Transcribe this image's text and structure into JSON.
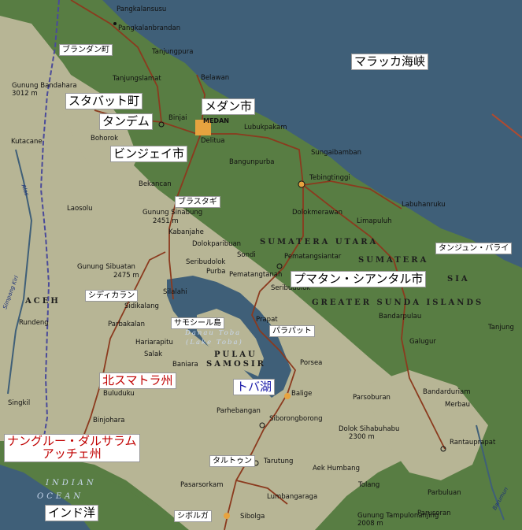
{
  "map": {
    "japanese_labels": {
      "malacca_strait": "マラッカ海峡",
      "medan_city": "メダン市",
      "stabat": "スタバット町",
      "tandem": "タンデム",
      "binjai_city": "ビンジェイ市",
      "brandan": "ブランダン町",
      "berastagi": "ブラスタギ",
      "tanjung_balai": "タンジュン・バライ",
      "pematangsiantar_city": "プマタン・シアンタル市",
      "sidikalang": "シディカラン",
      "samosir_island": "サモシール島",
      "parapat": "パラパット",
      "north_sumatra": "北スマトラ州",
      "lake_toba": "トバ湖",
      "aceh_province_line1": "ナングルー・ダルサラム",
      "aceh_province_line2": "アッチェ州",
      "tarutung": "タルトゥン",
      "indian_ocean": "インド洋",
      "sibolga": "シボルガ"
    },
    "places": {
      "pangkalansusu": "Pangkalansusu",
      "pangkalanbrandan": "Pangkalanbrandan",
      "tanjungpura": "Tanjungpura",
      "tanjungslamat": "Tanjungslamat",
      "belawan": "Belawan",
      "binjai": "Binjai",
      "medan": "MEDAN",
      "delitua": "Delitua",
      "bohorok": "Bohorok",
      "lubukpakam": "Lubukpakam",
      "kutacane": "Kutacane",
      "sungaibamban": "Sungaibamban",
      "bangunpurba": "Bangunpurba",
      "tebingtinggi": "Tebingtinggi",
      "bekancan": "Bekancan",
      "laosolu": "Laosolu",
      "kabanjahe": "Kabanjahe",
      "dolokmerawan": "Dolokmerawan",
      "labuhanruku": "Labuhanruku",
      "limapuluh": "Limapuluh",
      "dolokparibuan": "Dolokparibuan",
      "seribudolok": "Seribudolok",
      "sondi": "Sondi",
      "pematangsiantar": "Pematangsiantar",
      "purba": "Purba",
      "pematangtanah": "Pematangtanah",
      "seribudolok2": "Seribudolok",
      "silalahi": "Silalahi",
      "sidikalang": "Sidikalang",
      "rundeng": "Rundeng",
      "parbakalan": "Parbakalan",
      "bandarpulau": "Bandarpulau",
      "prapat": "Prapat",
      "hariarapitu": "Hariarapitu",
      "galugur": "Galugur",
      "tanjung": "Tanjung",
      "salak": "Salak",
      "baniara": "Baniara",
      "porsea": "Porsea",
      "buluduku": "Buluduku",
      "balige": "Balige",
      "parsoburan": "Parsoburan",
      "bandarduriam": "Bandarduriam",
      "singkil": "Singkil",
      "merbau": "Merbau",
      "parhebangan": "Parhebangan",
      "binjohara": "Binjohara",
      "siborongborong": "Siborongborong",
      "rantauprapat": "Rantauprapat",
      "tarutung": "Tarutung",
      "aek_humbang": "Aek Humbang",
      "pasarsorkam": "Pasarsorkam",
      "tolang": "Tolang",
      "lumbangaraga": "Lumbangaraga",
      "parbuluan": "Parbuluan",
      "sibolga": "Sibolga",
      "parusoran": "Parusoran"
    },
    "peaks": {
      "bandahara_name": "Gunung Bandahara",
      "bandahara_elev": "3012 m",
      "sinabung_name": "Gunung Sinabung",
      "sinabung_elev": "2451 m",
      "sibuatan_name": "Gunung Sibuatan",
      "sibuatan_elev": "2475 m",
      "sihabuhabu_name": "Dolok Sihabuhabu",
      "sihabuhabu_elev": "2300 m",
      "tampulonanjing_name": "Gunung Tampulonanjing",
      "tampulonanjing_elev": "2008 m"
    },
    "regions": {
      "sumatera_utara_1": "SUMATERA UTARA",
      "sumatera": "SUMATERA",
      "sia": "SIA",
      "greater_sunda": "GREATER SUNDA ISLANDS",
      "aceh": "ACEH",
      "pulau": "PULAU",
      "samosir": "SAMOSIR",
      "indian": "INDIAN",
      "ocean": "OCEAN",
      "danau_toba": "Danau Toba",
      "lake_toba": "(Lake Toba)"
    },
    "rivers": {
      "alas": "Alas",
      "simpang_kiri": "Simpang Kiri",
      "barumun": "Barumun"
    },
    "colors": {
      "sea": "#3f5f78",
      "lowland": "#587d43",
      "upland": "#b7b595",
      "road": "#8b3a1e",
      "border": "#4a4a9a",
      "lake": "#3f5f78"
    }
  }
}
